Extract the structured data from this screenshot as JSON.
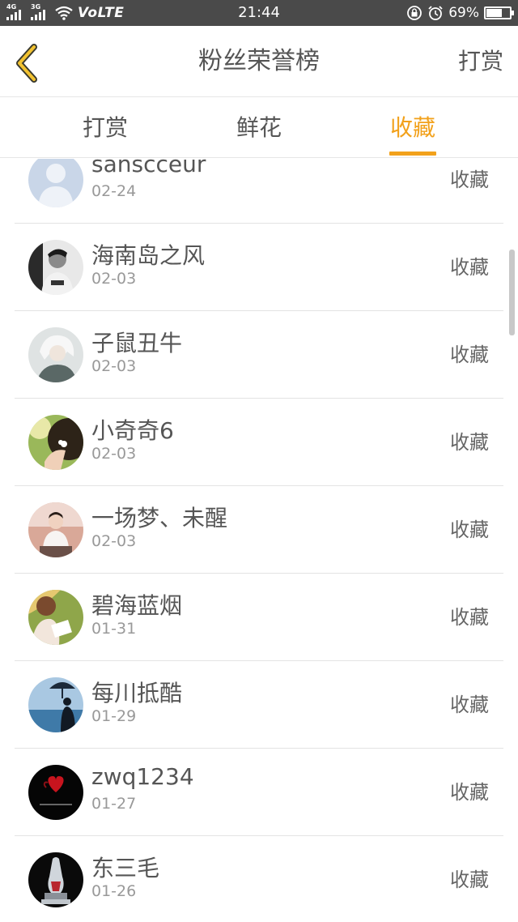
{
  "status_bar": {
    "network_top": "4G",
    "network_top2": "3G",
    "volte": "VoLTE",
    "time": "21:44",
    "battery_percent_text": "69%",
    "battery_level": 0.69
  },
  "nav": {
    "title": "粉丝荣誉榜",
    "action_label": "打赏"
  },
  "tabs": [
    {
      "label": "打赏",
      "active": false
    },
    {
      "label": "鲜花",
      "active": false
    },
    {
      "label": "收藏",
      "active": true
    }
  ],
  "accent_color": "#f2a11b",
  "items": [
    {
      "name": "sanscceur",
      "date": "02-24",
      "action": "收藏",
      "avatar": "default-avatar"
    },
    {
      "name": "海南岛之风",
      "date": "02-03",
      "action": "收藏",
      "avatar": "bw-portrait-avatar"
    },
    {
      "name": "子鼠丑牛",
      "date": "02-03",
      "action": "收藏",
      "avatar": "anime-white-hair-avatar"
    },
    {
      "name": "小奇奇6",
      "date": "02-03",
      "action": "收藏",
      "avatar": "flower-hair-avatar"
    },
    {
      "name": "一场梦、未醒",
      "date": "02-03",
      "action": "收藏",
      "avatar": "seated-boy-avatar"
    },
    {
      "name": "碧海蓝烟",
      "date": "01-31",
      "action": "收藏",
      "avatar": "reading-girl-avatar"
    },
    {
      "name": "每川抵酷",
      "date": "01-29",
      "action": "收藏",
      "avatar": "sea-umbrella-avatar"
    },
    {
      "name": "zwq1234",
      "date": "01-27",
      "action": "收藏",
      "avatar": "red-heart-black-avatar"
    },
    {
      "name": "东三毛",
      "date": "01-26",
      "action": "收藏",
      "avatar": "crystal-figure-avatar"
    }
  ]
}
